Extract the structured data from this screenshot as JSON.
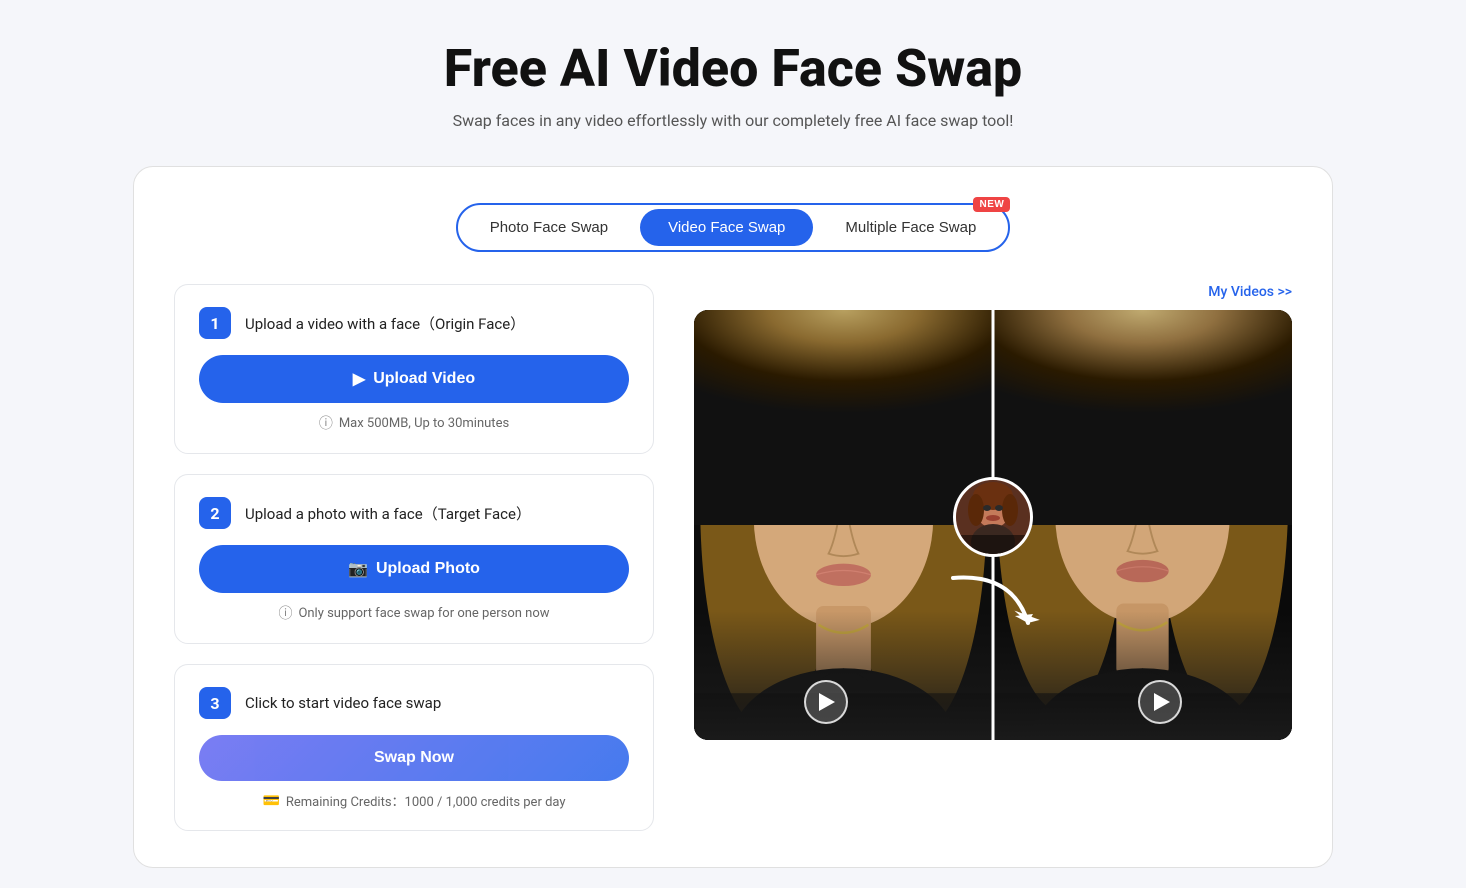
{
  "header": {
    "title": "Free AI Video Face Swap",
    "subtitle": "Swap faces in any video effortlessly with our completely free AI face swap tool!"
  },
  "tabs": [
    {
      "id": "photo",
      "label": "Photo Face Swap",
      "active": false,
      "badge": null
    },
    {
      "id": "video",
      "label": "Video Face Swap",
      "active": true,
      "badge": null
    },
    {
      "id": "multiple",
      "label": "Multiple Face Swap",
      "active": false,
      "badge": "NEW"
    }
  ],
  "my_videos_link": "My Videos >>",
  "steps": [
    {
      "number": "1",
      "label": "Upload a video with a face（Origin Face）",
      "button_label": "Upload Video",
      "button_icon": "play-circle",
      "hint_icon": "info",
      "hint": "Max 500MB, Up to 30minutes"
    },
    {
      "number": "2",
      "label": "Upload a photo with a face（Target Face）",
      "button_label": "Upload Photo",
      "button_icon": "image",
      "hint_icon": "info",
      "hint": "Only support face swap for one person now"
    },
    {
      "number": "3",
      "label": "Click to start video face swap",
      "button_label": "Swap Now",
      "button_icon": null,
      "hint_icon": "credits",
      "hint": "Remaining Credits：1000 / 1,000 credits per day"
    }
  ],
  "colors": {
    "primary": "#2563eb",
    "danger": "#ef4444",
    "text_primary": "#111",
    "text_secondary": "#555",
    "border": "#e5e7eb",
    "card_bg": "#fff",
    "page_bg": "#f5f6fa"
  }
}
